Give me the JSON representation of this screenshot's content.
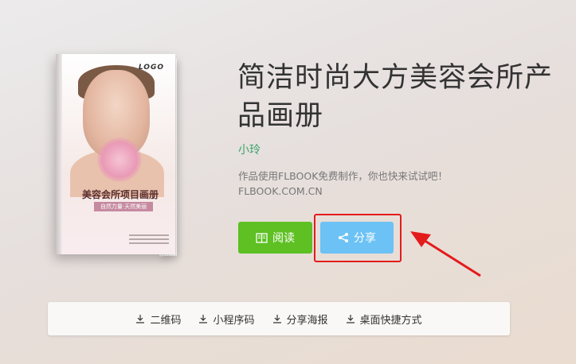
{
  "cover": {
    "logo": "LOGO",
    "title": "美容会所项目画册",
    "subtitle": "自然力量·天然美丽"
  },
  "book": {
    "title": "简洁时尚大方美容会所产品画册",
    "author": "小玲",
    "desc_line1": "作品使用FLBOOK免费制作，你也快来试试吧！",
    "desc_line2": "FLBOOK.COM.CN"
  },
  "buttons": {
    "read_label": "阅读",
    "share_label": "分享"
  },
  "colors": {
    "read_bg": "#5ec023",
    "share_bg": "#6cc2f5",
    "author": "#3aa36a",
    "highlight": "#e31b1b"
  },
  "bottom_bar": {
    "items": [
      {
        "label": "二维码",
        "icon": "download-icon"
      },
      {
        "label": "小程序码",
        "icon": "download-icon"
      },
      {
        "label": "分享海报",
        "icon": "download-icon"
      },
      {
        "label": "桌面快捷方式",
        "icon": "download-icon"
      }
    ]
  }
}
